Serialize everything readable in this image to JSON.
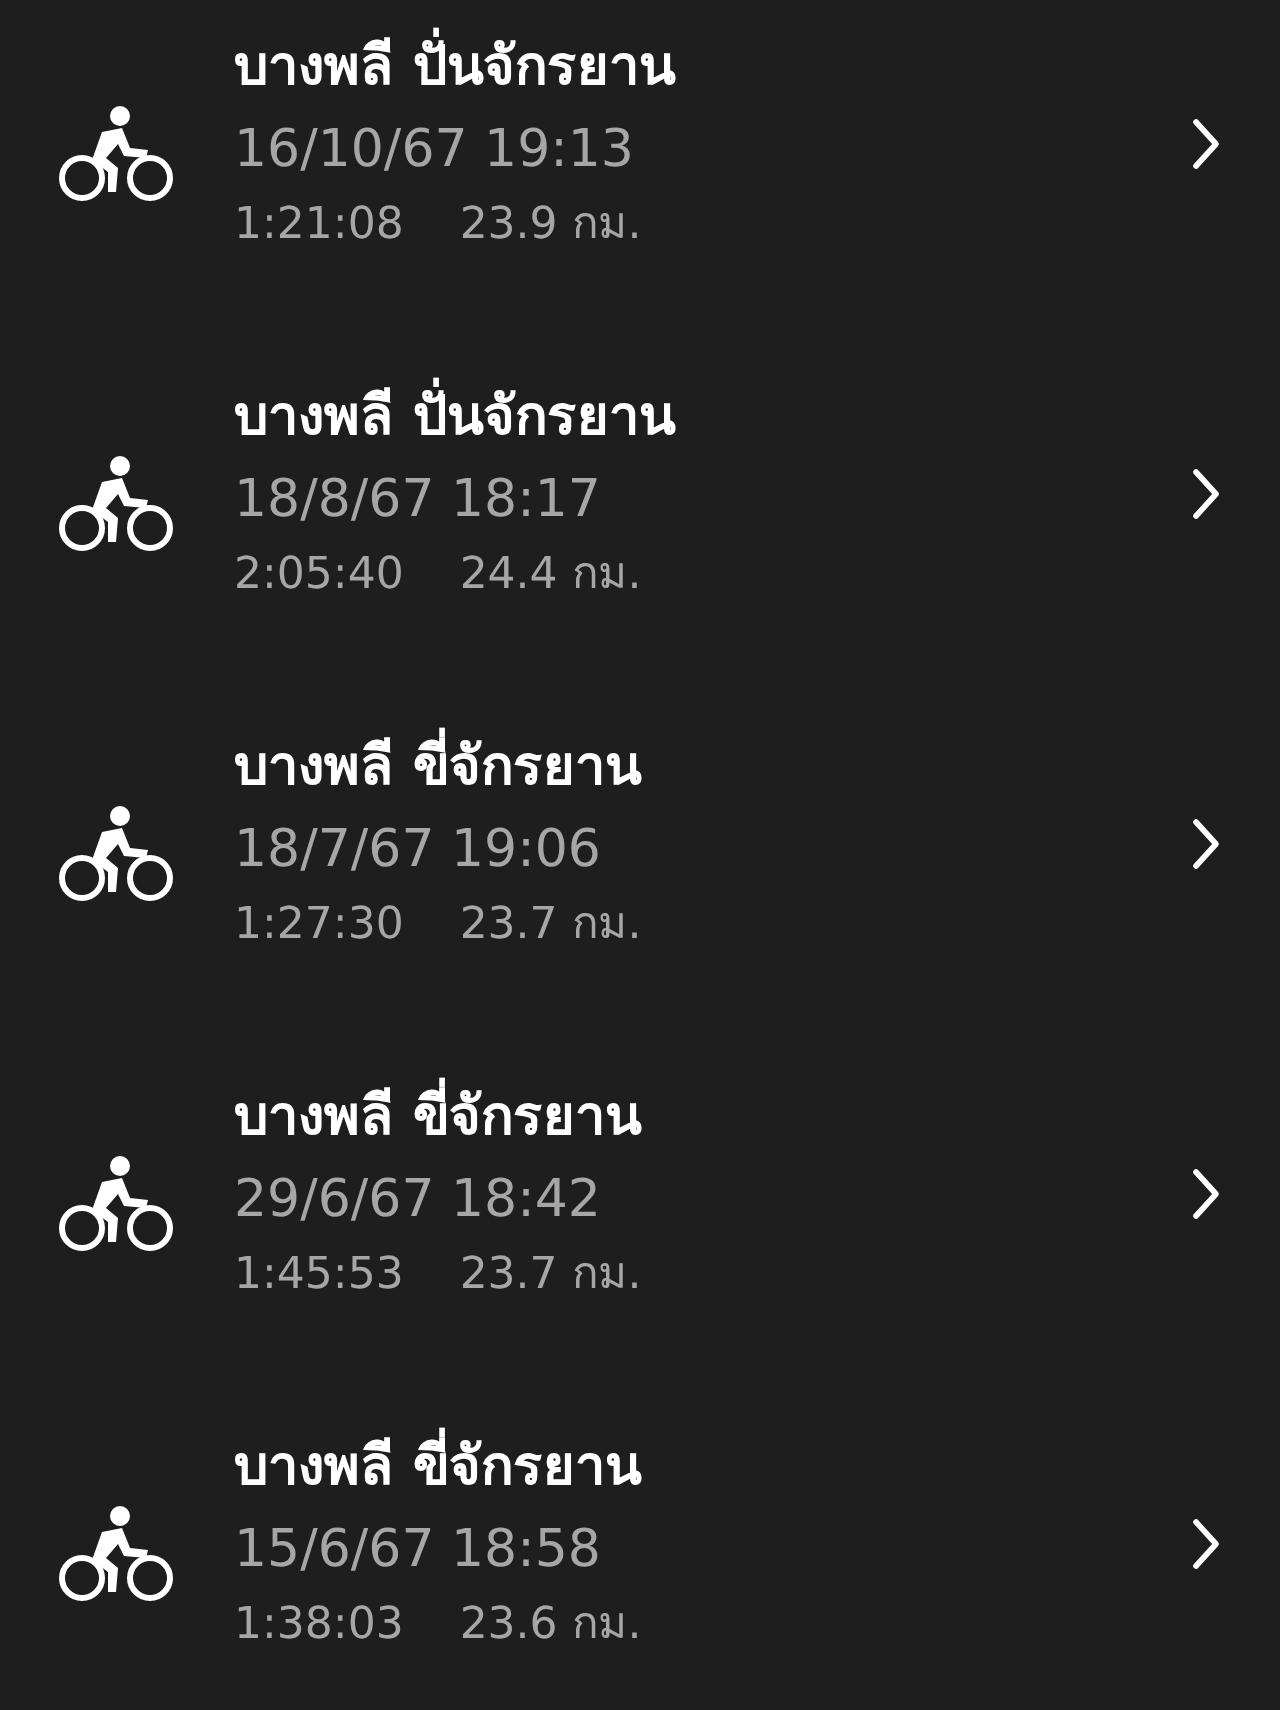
{
  "rides": [
    {
      "title": "บางพลี ปั่นจักรยาน",
      "date": "16/10/67 19:13",
      "duration": "1:21:08",
      "distance": "23.9 กม."
    },
    {
      "title": "บางพลี ปั่นจักรยาน",
      "date": "18/8/67 18:17",
      "duration": "2:05:40",
      "distance": "24.4 กม."
    },
    {
      "title": "บางพลี ขี่จักรยาน",
      "date": "18/7/67 19:06",
      "duration": "1:27:30",
      "distance": "23.7 กม."
    },
    {
      "title": "บางพลี ขี่จักรยาน",
      "date": "29/6/67 18:42",
      "duration": "1:45:53",
      "distance": "23.7 กม."
    },
    {
      "title": "บางพลี ขี่จักรยาน",
      "date": "15/6/67 18:58",
      "duration": "1:38:03",
      "distance": "23.6 กม."
    }
  ]
}
